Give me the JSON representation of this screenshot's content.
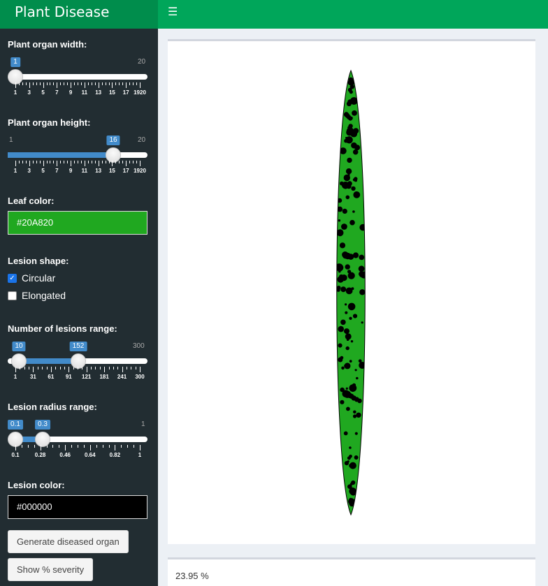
{
  "app": {
    "title": "Plant Disease TraineR",
    "menu_icon": "hamburger-icon"
  },
  "sidebar": {
    "organ_width": {
      "label": "Plant organ width:",
      "min": 1,
      "max": 20,
      "value": 1,
      "min_label": "1",
      "max_label": "20",
      "value_label": "1",
      "grid": [
        "1",
        "3",
        "5",
        "7",
        "9",
        "11",
        "13",
        "15",
        "17",
        "1920"
      ]
    },
    "organ_height": {
      "label": "Plant organ height:",
      "min": 1,
      "max": 20,
      "value": 16,
      "min_label": "1",
      "max_label": "20",
      "value_label": "16",
      "grid": [
        "1",
        "3",
        "5",
        "7",
        "9",
        "11",
        "13",
        "15",
        "17",
        "1920"
      ]
    },
    "leaf_color": {
      "label": "Leaf color:",
      "value": "#20A820"
    },
    "lesion_shape": {
      "label": "Lesion shape:",
      "options": [
        {
          "label": "Circular",
          "checked": true
        },
        {
          "label": "Elongated",
          "checked": false
        }
      ]
    },
    "lesion_count": {
      "label": "Number of lesions range:",
      "min": 1,
      "max": 300,
      "from": 10,
      "to": 152,
      "from_label": "10",
      "to_label": "152",
      "max_label": "300",
      "grid": [
        "1",
        "31",
        "61",
        "91",
        "121",
        "181",
        "241",
        "300"
      ]
    },
    "lesion_radius": {
      "label": "Lesion radius range:",
      "min": 0.1,
      "max": 1,
      "from": 0.1,
      "to": 0.3,
      "from_label": "0.1",
      "to_label": "0.3",
      "max_label": "1",
      "grid": [
        "0.1",
        "0.28",
        "0.46",
        "0.64",
        "0.82",
        "1"
      ]
    },
    "lesion_color": {
      "label": "Lesion color:",
      "value": "#000000"
    },
    "generate_button": "Generate diseased organ",
    "severity_button": "Show % severity"
  },
  "main": {
    "severity_text": "23.95 %",
    "leaf_fill": "#20A820",
    "lesion_fill": "#000000"
  }
}
